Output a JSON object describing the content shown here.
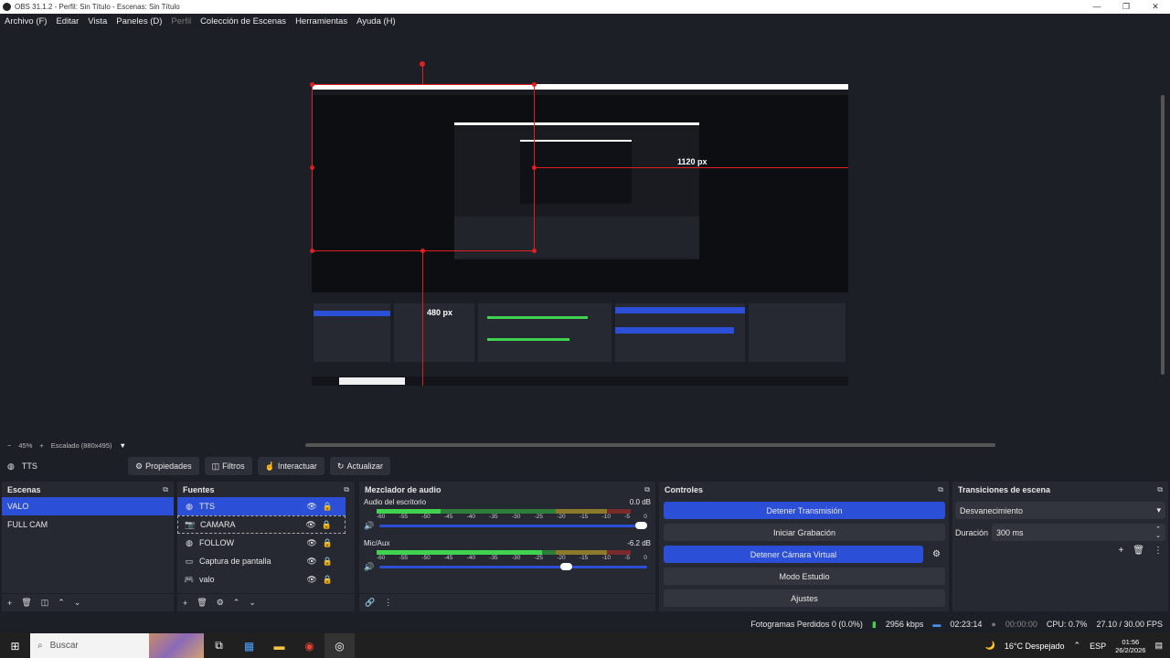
{
  "window": {
    "title": "OBS 31.1.2 - Perfil: Sin Título - Escenas: Sin Título",
    "minimize": "—",
    "maximize": "❐",
    "close": "✕"
  },
  "menu": {
    "items": [
      "Archivo (F)",
      "Editar",
      "Vista",
      "Paneles (D)",
      "Perfil",
      "Colección de Escenas",
      "Herramientas",
      "Ayuda (H)"
    ]
  },
  "preview": {
    "label_horizontal": "1120 px",
    "label_vertical": "480 px"
  },
  "zoom": {
    "minus": "−",
    "level": "45%",
    "plus": "+",
    "mode": "Escalado (880x495)",
    "dropdown": "▼"
  },
  "source_toolbar": {
    "current_source": "TTS",
    "properties": "Propiedades",
    "filters": "Filtros",
    "interact": "Interactuar",
    "refresh": "Actualizar"
  },
  "scenes": {
    "title": "Escenas",
    "items": [
      "VALO",
      "FULL CAM"
    ],
    "selected": 0
  },
  "sources": {
    "title": "Fuentes",
    "items": [
      {
        "name": "TTS",
        "icon": "browser-icon"
      },
      {
        "name": "CAMARA",
        "icon": "camera-icon"
      },
      {
        "name": "FOLLOW",
        "icon": "browser-icon"
      },
      {
        "name": "Captura de pantalla",
        "icon": "monitor-icon"
      },
      {
        "name": "valo",
        "icon": "gamepad-icon"
      }
    ],
    "selected": 0
  },
  "mixer": {
    "title": "Mezclador de audio",
    "tracks": [
      {
        "name": "Audio del escritorio",
        "db": "0.0 dB",
        "level": 0.25,
        "volume": 1.0
      },
      {
        "name": "Mic/Aux",
        "db": "-6.2 dB",
        "level": 0.65,
        "volume": 0.72
      }
    ],
    "ticks": [
      "-60",
      "-55",
      "-50",
      "-45",
      "-40",
      "-35",
      "-30",
      "-25",
      "-20",
      "-15",
      "-10",
      "-5",
      "0"
    ]
  },
  "controls": {
    "title": "Controles",
    "stop_stream": "Detener Transmisión",
    "start_record": "Iniciar Grabación",
    "stop_virtualcam": "Detener Cámara Virtual",
    "studio_mode": "Modo Estudio",
    "settings": "Ajustes"
  },
  "transitions": {
    "title": "Transiciones de escena",
    "selected": "Desvanecimiento",
    "duration_label": "Duración",
    "duration_value": "300 ms"
  },
  "status": {
    "dropped_frames": "Fotogramas Perdidos 0 (0.0%)",
    "bitrate": "2956 kbps",
    "stream_time": "02:23:14",
    "record_time": "00:00:00",
    "cpu": "CPU: 0.7%",
    "fps": "27.10 / 30.00 FPS"
  },
  "taskbar": {
    "search_placeholder": "Buscar",
    "weather": "16°C  Despejado",
    "language": "ESP",
    "time": "01:56",
    "date": "26/2/2026"
  }
}
